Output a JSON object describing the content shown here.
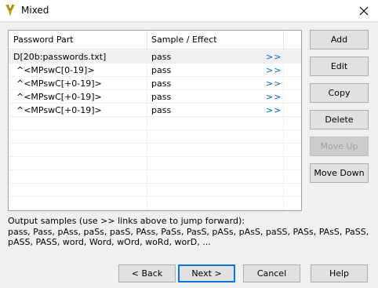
{
  "window": {
    "title": "Mixed",
    "close_glyph": "✕"
  },
  "table": {
    "columns": [
      "Password Part",
      "Sample / Effect"
    ],
    "rows": [
      {
        "part": "D[20b:passwords.txt]",
        "effect": "pass",
        "link": ">>"
      },
      {
        "part": "^<MPswC[0-19]>",
        "effect": "pass",
        "link": ">>"
      },
      {
        "part": "^<MPswC[+0-19]>",
        "effect": "pass",
        "link": ">>"
      },
      {
        "part": "^<MPswC[+0-19]>",
        "effect": "pass",
        "link": ">>"
      },
      {
        "part": "^<MPswC[+0-19]>",
        "effect": "pass",
        "link": ">>"
      }
    ]
  },
  "side_buttons": {
    "add": "Add",
    "edit": "Edit",
    "copy": "Copy",
    "delete": "Delete",
    "move_up": "Move Up",
    "move_down": "Move Down"
  },
  "output": {
    "label": "Output samples (use >> links above to jump forward):",
    "samples": "pass, Pass, pAss, paSs, pasS, PAss, PaSs, PasS, pASs, pAsS, paSS, PASs, PAsS, PaSS, pASS, PASS, word, Word, wOrd, woRd, worD, ..."
  },
  "footer": {
    "back": "< Back",
    "next": "Next >",
    "cancel": "Cancel",
    "help": "Help"
  },
  "colors": {
    "link": "#0066cc",
    "accent_border": "#0078d7",
    "icon_gold": "#c8a000"
  }
}
